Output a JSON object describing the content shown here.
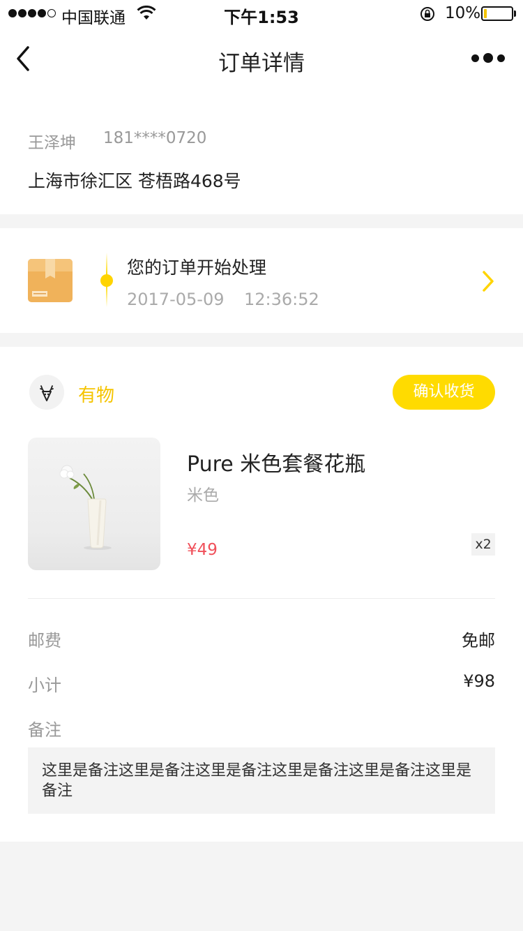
{
  "status_bar": {
    "carrier": "中国联通",
    "time": "下午1:53",
    "battery_percent": "10%",
    "battery_level": 0.1,
    "signal_bars": 4,
    "signal_total": 5,
    "accent_color": "#f5c400",
    "icons": [
      "signal-icon",
      "wifi-icon",
      "orientation-lock-icon",
      "battery-icon"
    ]
  },
  "nav": {
    "title": "订单详情",
    "back_icon": "chevron-left-icon",
    "more_icon": "more-dots-icon"
  },
  "address": {
    "name": "王泽坤",
    "phone": "181****0720",
    "line": "上海市徐汇区 苍梧路468号"
  },
  "logistics": {
    "icon": "package-box-icon",
    "status": "您的订单开始处理",
    "date": "2017-05-09",
    "time": "12:36:52",
    "arrow_icon": "chevron-right-icon"
  },
  "order": {
    "shop": {
      "name": "有物",
      "logo_icon": "deer-logo-icon"
    },
    "confirm_button": "确认收货",
    "product": {
      "image_icon": "vase-product-image",
      "name": "Pure 米色套餐花瓶",
      "variant": "米色",
      "price": "¥49",
      "quantity": "x2"
    },
    "shipping": {
      "label": "邮费",
      "value": "免邮"
    },
    "subtotal": {
      "label": "小计",
      "value": "¥98"
    },
    "remark": {
      "label": "备注",
      "text": "这里是备注这里是备注这里是备注这里是备注这里是备注这里是备注"
    }
  },
  "colors": {
    "accent_yellow": "#ffdb00",
    "price_red": "#f0505a",
    "background": "#f4f4f4"
  }
}
